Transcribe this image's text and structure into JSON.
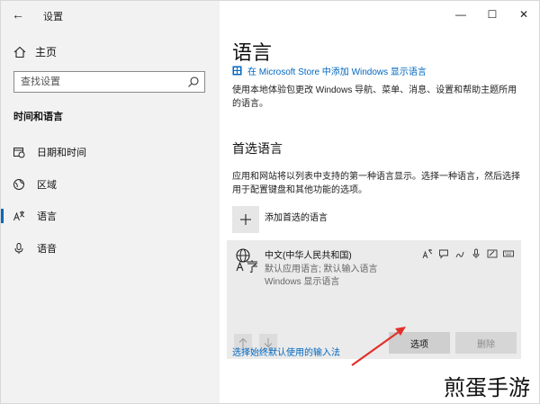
{
  "window": {
    "title": "设置",
    "controls": {
      "minimize": "—",
      "maximize": "☐",
      "close": "✕"
    }
  },
  "sidebar": {
    "home_label": "主页",
    "search_placeholder": "查找设置",
    "section_title": "时间和语言",
    "items": [
      {
        "label": "日期和时间",
        "icon": "calendar-clock-icon",
        "active": false
      },
      {
        "label": "区域",
        "icon": "globe-icon",
        "active": false
      },
      {
        "label": "语言",
        "icon": "language-icon",
        "active": true
      },
      {
        "label": "语音",
        "icon": "microphone-icon",
        "active": false
      }
    ]
  },
  "main": {
    "title": "语言",
    "store_link": "在 Microsoft Store 中添加 Windows 显示语言",
    "description": "使用本地体验包更改 Windows 导航、菜单、消息、设置和帮助主题所用的语言。",
    "preferred_heading": "首选语言",
    "preferred_description": "应用和网站将以列表中支持的第一种语言显示。选择一种语言，然后选择用于配置键盘和其他功能的选项。",
    "add_language_label": "添加首选的语言",
    "language_card": {
      "name": "中文(中华人民共和国)",
      "subtitle1": "默认应用语言; 默认输入语言",
      "subtitle2": "Windows 显示语言",
      "options_label": "选项",
      "remove_label": "删除"
    },
    "keyboard_link": "选择始终默认使用的输入法"
  },
  "watermark": "煎蛋手游",
  "colors": {
    "accent": "#0067c0",
    "sidebar_bg": "#f2f2f2",
    "card_bg": "#ebebeb",
    "annotation_arrow": "#e0322b"
  }
}
